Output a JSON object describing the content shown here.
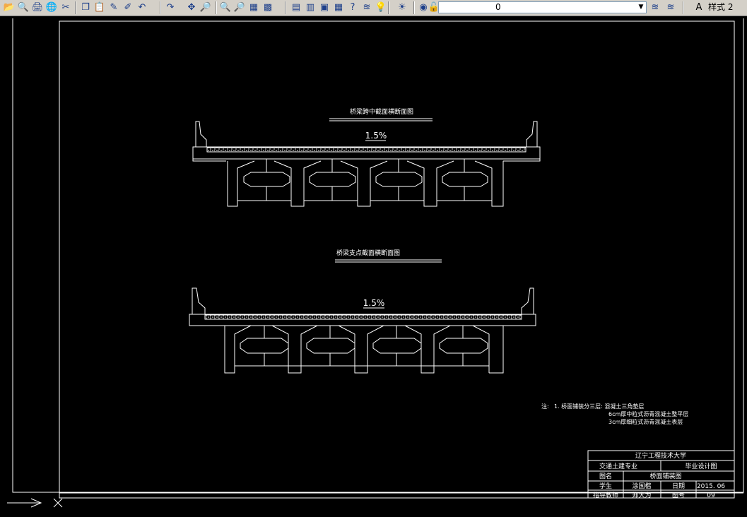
{
  "toolbar": {
    "buttons": [
      {
        "name": "open-icon",
        "glyph": "📂"
      },
      {
        "name": "plot-preview-icon",
        "glyph": "🔍"
      },
      {
        "name": "publish-icon",
        "glyph": "🖨"
      },
      {
        "name": "globe-icon",
        "glyph": "🌐"
      },
      {
        "name": "cut-icon",
        "glyph": "✂"
      },
      {
        "name": "copy-icon",
        "glyph": "❐"
      },
      {
        "name": "paste-icon",
        "glyph": "📋"
      },
      {
        "name": "match-properties-icon",
        "glyph": "✎"
      },
      {
        "name": "block-editor-icon",
        "glyph": "✐"
      },
      {
        "name": "undo-icon",
        "glyph": "↶"
      },
      {
        "name": "redo-icon",
        "glyph": "↷"
      },
      {
        "name": "pan-icon",
        "glyph": "✥"
      },
      {
        "name": "zoom-realtime-icon",
        "glyph": "🔎"
      },
      {
        "name": "zoom-window-icon",
        "glyph": "🔍"
      },
      {
        "name": "zoom-previous-icon",
        "glyph": "🔎"
      },
      {
        "name": "properties-icon",
        "glyph": "▦"
      },
      {
        "name": "design-center-icon",
        "glyph": "▩"
      },
      {
        "name": "tool-palettes-icon",
        "glyph": "▤"
      },
      {
        "name": "sheet-set-icon",
        "glyph": "▥"
      },
      {
        "name": "markup-icon",
        "glyph": "▣"
      },
      {
        "name": "calculator-icon",
        "glyph": "▦"
      },
      {
        "name": "help-icon",
        "glyph": "?"
      },
      {
        "name": "layer-manager-icon",
        "glyph": "≋"
      },
      {
        "name": "layer-on-icon",
        "glyph": "💡"
      },
      {
        "name": "layer-freeze-icon",
        "glyph": "☀"
      },
      {
        "name": "layer-viewport-icon",
        "glyph": "◉"
      },
      {
        "name": "layer-lock-icon",
        "glyph": "🔓"
      }
    ],
    "layer_name": "0",
    "style_label": "样式 2"
  },
  "drawing": {
    "section1_title": "桥梁跨中截面横断面图",
    "section1_slope": "1.5%",
    "section2_title": "桥梁支点截面横断面图",
    "section2_slope": "1.5%",
    "note_label": "注:",
    "note_line1": "1. 桥面铺装分三层:  混凝土三角垫层",
    "note_line2": "6cm厚中粒式沥青混凝土整平层",
    "note_line3": "3cm厚细粒式沥青混凝土表层"
  },
  "title_block": {
    "university": "辽宁工程技术大学",
    "major": "交通土建专业",
    "design_type": "毕业设计图",
    "drawing_name_label": "图名",
    "drawing_name": "桥面铺装图",
    "student_label": "学生",
    "student_name": "涂国楷",
    "date_label": "日期",
    "date_value": "2015. 06",
    "advisor_label": "指导教师",
    "advisor_name": "郑大为",
    "drawing_no_label": "图号",
    "drawing_no": "09"
  }
}
